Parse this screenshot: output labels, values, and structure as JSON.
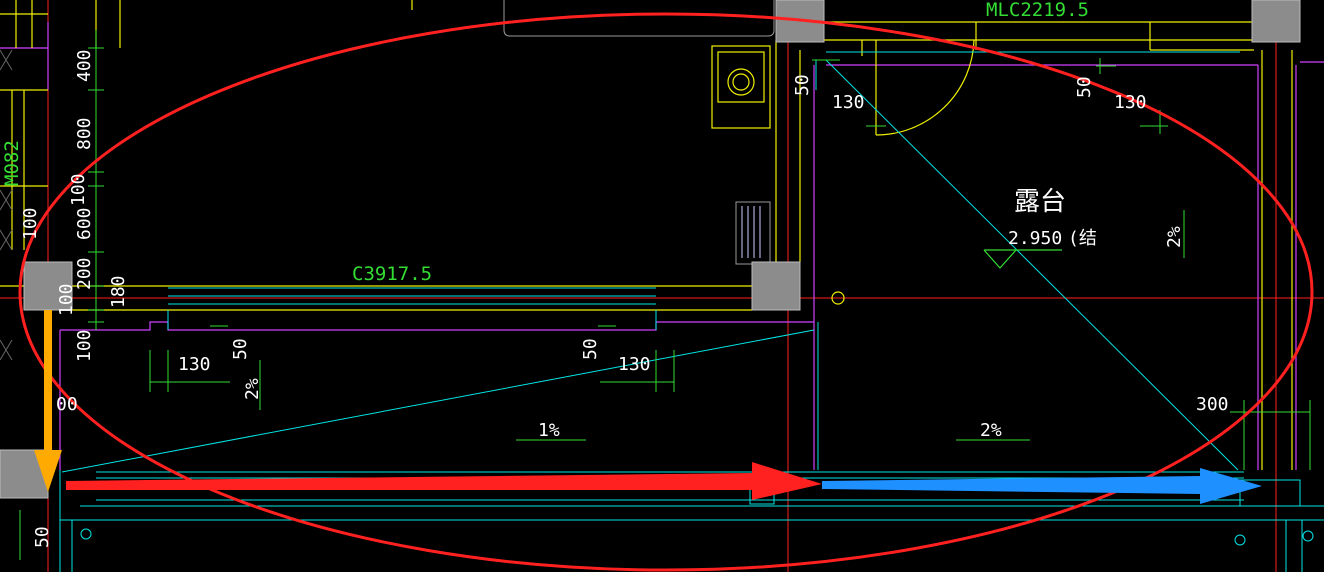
{
  "labels": {
    "window_label": "C3917.5",
    "top_label": "MLC2219.5",
    "side_label": "M082",
    "room_name": "露台",
    "elevation": "2.950",
    "elevation_suffix": "(结"
  },
  "dims_left": [
    "400",
    "800",
    "100",
    "600",
    "200",
    "180",
    "100",
    "100",
    "100",
    "00",
    "50"
  ],
  "dims_mid": [
    "130",
    "50",
    "50",
    "130"
  ],
  "dims_right": [
    "50",
    "130",
    "50",
    "130",
    "300"
  ],
  "slopes": [
    "2%",
    "1%",
    "2%",
    "2%"
  ],
  "colors": {
    "axis_line": "#ff2020",
    "wall_line": "#f0f000",
    "cyan_line": "#00e5e5",
    "magenta_line": "#d040ff",
    "green_dim": "#33dd33",
    "column_fill": "#8c8c8c",
    "arrow_orange": "#ffaa00",
    "arrow_red": "#ff2020",
    "arrow_blue": "#1e90ff"
  }
}
